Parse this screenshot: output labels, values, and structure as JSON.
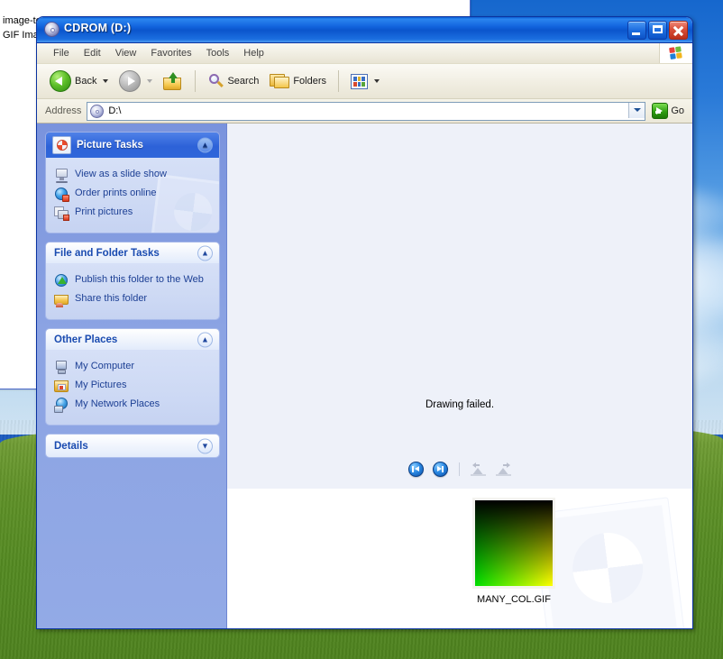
{
  "desktop": {
    "background_window": {
      "line1": "image-test.gif",
      "line2": "GIF Image"
    }
  },
  "window": {
    "title": "CDROM (D:)",
    "icon": "cdrom-icon",
    "controls": {
      "minimize": "Minimize",
      "maximize": "Maximize",
      "close": "Close"
    },
    "menu": [
      "File",
      "Edit",
      "View",
      "Favorites",
      "Tools",
      "Help"
    ],
    "toolbar": {
      "back": "Back",
      "forward": "",
      "up": "",
      "search": "Search",
      "folders": "Folders",
      "views": ""
    },
    "address": {
      "label": "Address",
      "value": "D:\\",
      "go": "Go"
    }
  },
  "sidebar": {
    "panels": [
      {
        "title": "Picture Tasks",
        "style": "blue",
        "chevron": "chevron-up",
        "items": [
          {
            "label": "View as a slide show",
            "icon": "slideshow-icon"
          },
          {
            "label": "Order prints online",
            "icon": "order-prints-icon"
          },
          {
            "label": "Print pictures",
            "icon": "print-pictures-icon"
          }
        ]
      },
      {
        "title": "File and Folder Tasks",
        "style": "white",
        "chevron": "chevron-up",
        "items": [
          {
            "label": "Publish this folder to the Web",
            "icon": "publish-web-icon"
          },
          {
            "label": "Share this folder",
            "icon": "share-folder-icon"
          }
        ]
      },
      {
        "title": "Other Places",
        "style": "white",
        "chevron": "chevron-up",
        "items": [
          {
            "label": "My Computer",
            "icon": "my-computer-icon"
          },
          {
            "label": "My Pictures",
            "icon": "my-pictures-icon"
          },
          {
            "label": "My Network Places",
            "icon": "my-network-places-icon"
          }
        ]
      },
      {
        "title": "Details",
        "style": "white",
        "chevron": "chevron-down",
        "items": []
      }
    ]
  },
  "preview": {
    "message": "Drawing failed.",
    "controls": [
      {
        "name": "previous-image-button",
        "label": "Previous Image",
        "enabled": true
      },
      {
        "name": "next-image-button",
        "label": "Next Image",
        "enabled": true
      },
      {
        "name": "rotate-counterclockwise-button",
        "label": "Rotate Counterclockwise",
        "enabled": false
      },
      {
        "name": "rotate-clockwise-button",
        "label": "Rotate Clockwise",
        "enabled": false
      }
    ]
  },
  "filmstrip": {
    "items": [
      {
        "filename": "MANY_COL.GIF",
        "selected": false
      }
    ]
  },
  "colors": {
    "titlebar_blue": "#0b55cc",
    "panel_header_blue": "#2d62d8",
    "panel_body": "#cdd9f4",
    "sidebar_bg": "#8ba3e3",
    "link_text": "#1c3f94",
    "preview_bg": "#eef1f9",
    "close_button_red": "#d84f39",
    "go_button_green": "#2f9e12"
  }
}
